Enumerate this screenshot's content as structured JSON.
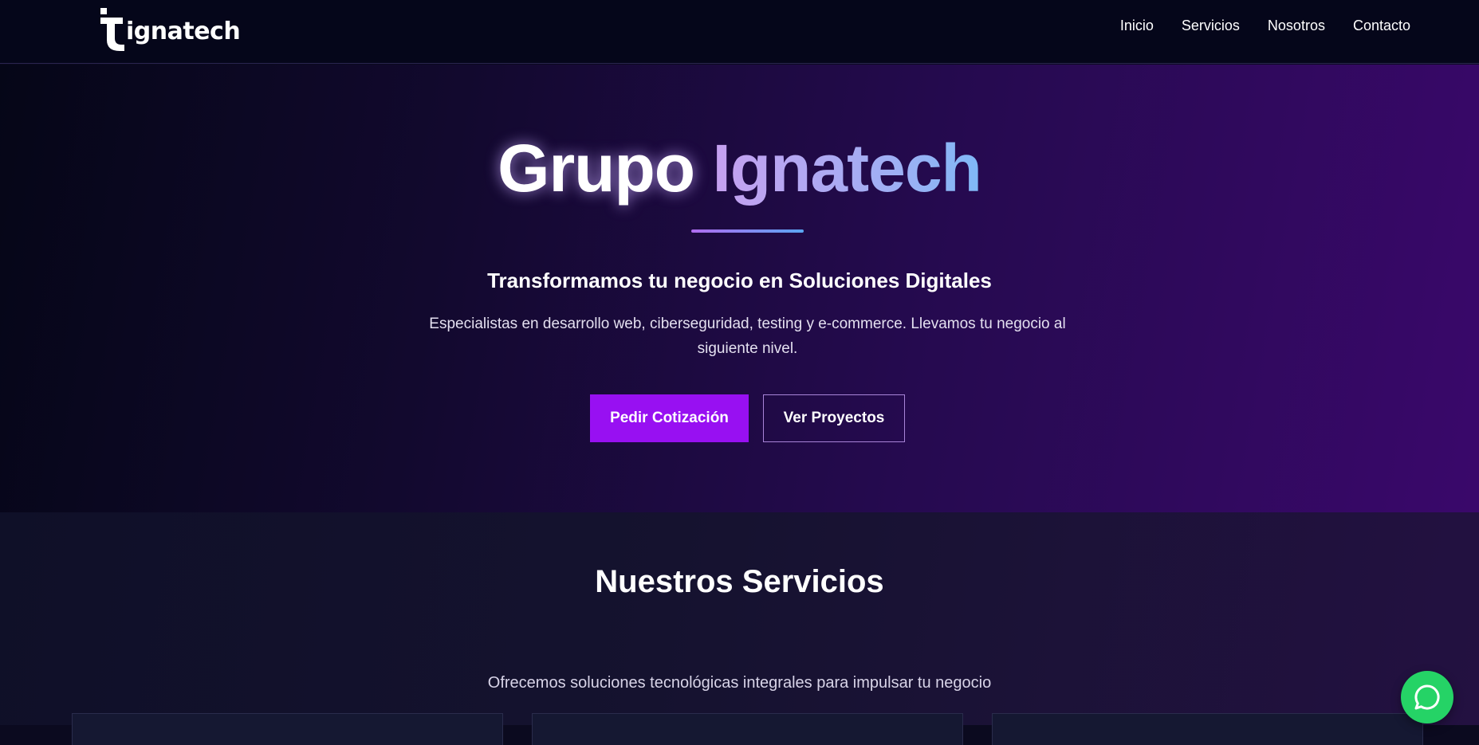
{
  "nav": {
    "logo_text": "ignatech",
    "links": [
      {
        "label": "Inicio"
      },
      {
        "label": "Servicios"
      },
      {
        "label": "Nosotros"
      },
      {
        "label": "Contacto"
      }
    ]
  },
  "hero": {
    "title_part1": "Grupo",
    "title_part2": "Ignatech",
    "subtitle": "Transformamos tu negocio en Soluciones Digitales",
    "description": "Especialistas en desarrollo web, ciberseguridad, testing y e-commerce. Llevamos tu negocio al siguiente nivel.",
    "primary_button": "Pedir Cotización",
    "secondary_button": "Ver Proyectos"
  },
  "services": {
    "title": "Nuestros Servicios",
    "subtitle": "Ofrecemos soluciones tecnológicas integrales para impulsar tu negocio"
  },
  "colors": {
    "accent": "#9810f2",
    "whatsapp": "#25d366",
    "nav_bg": "#05061a"
  },
  "icons": {
    "floating": "whatsapp-icon",
    "logo": "ignatech-logo-icon"
  }
}
